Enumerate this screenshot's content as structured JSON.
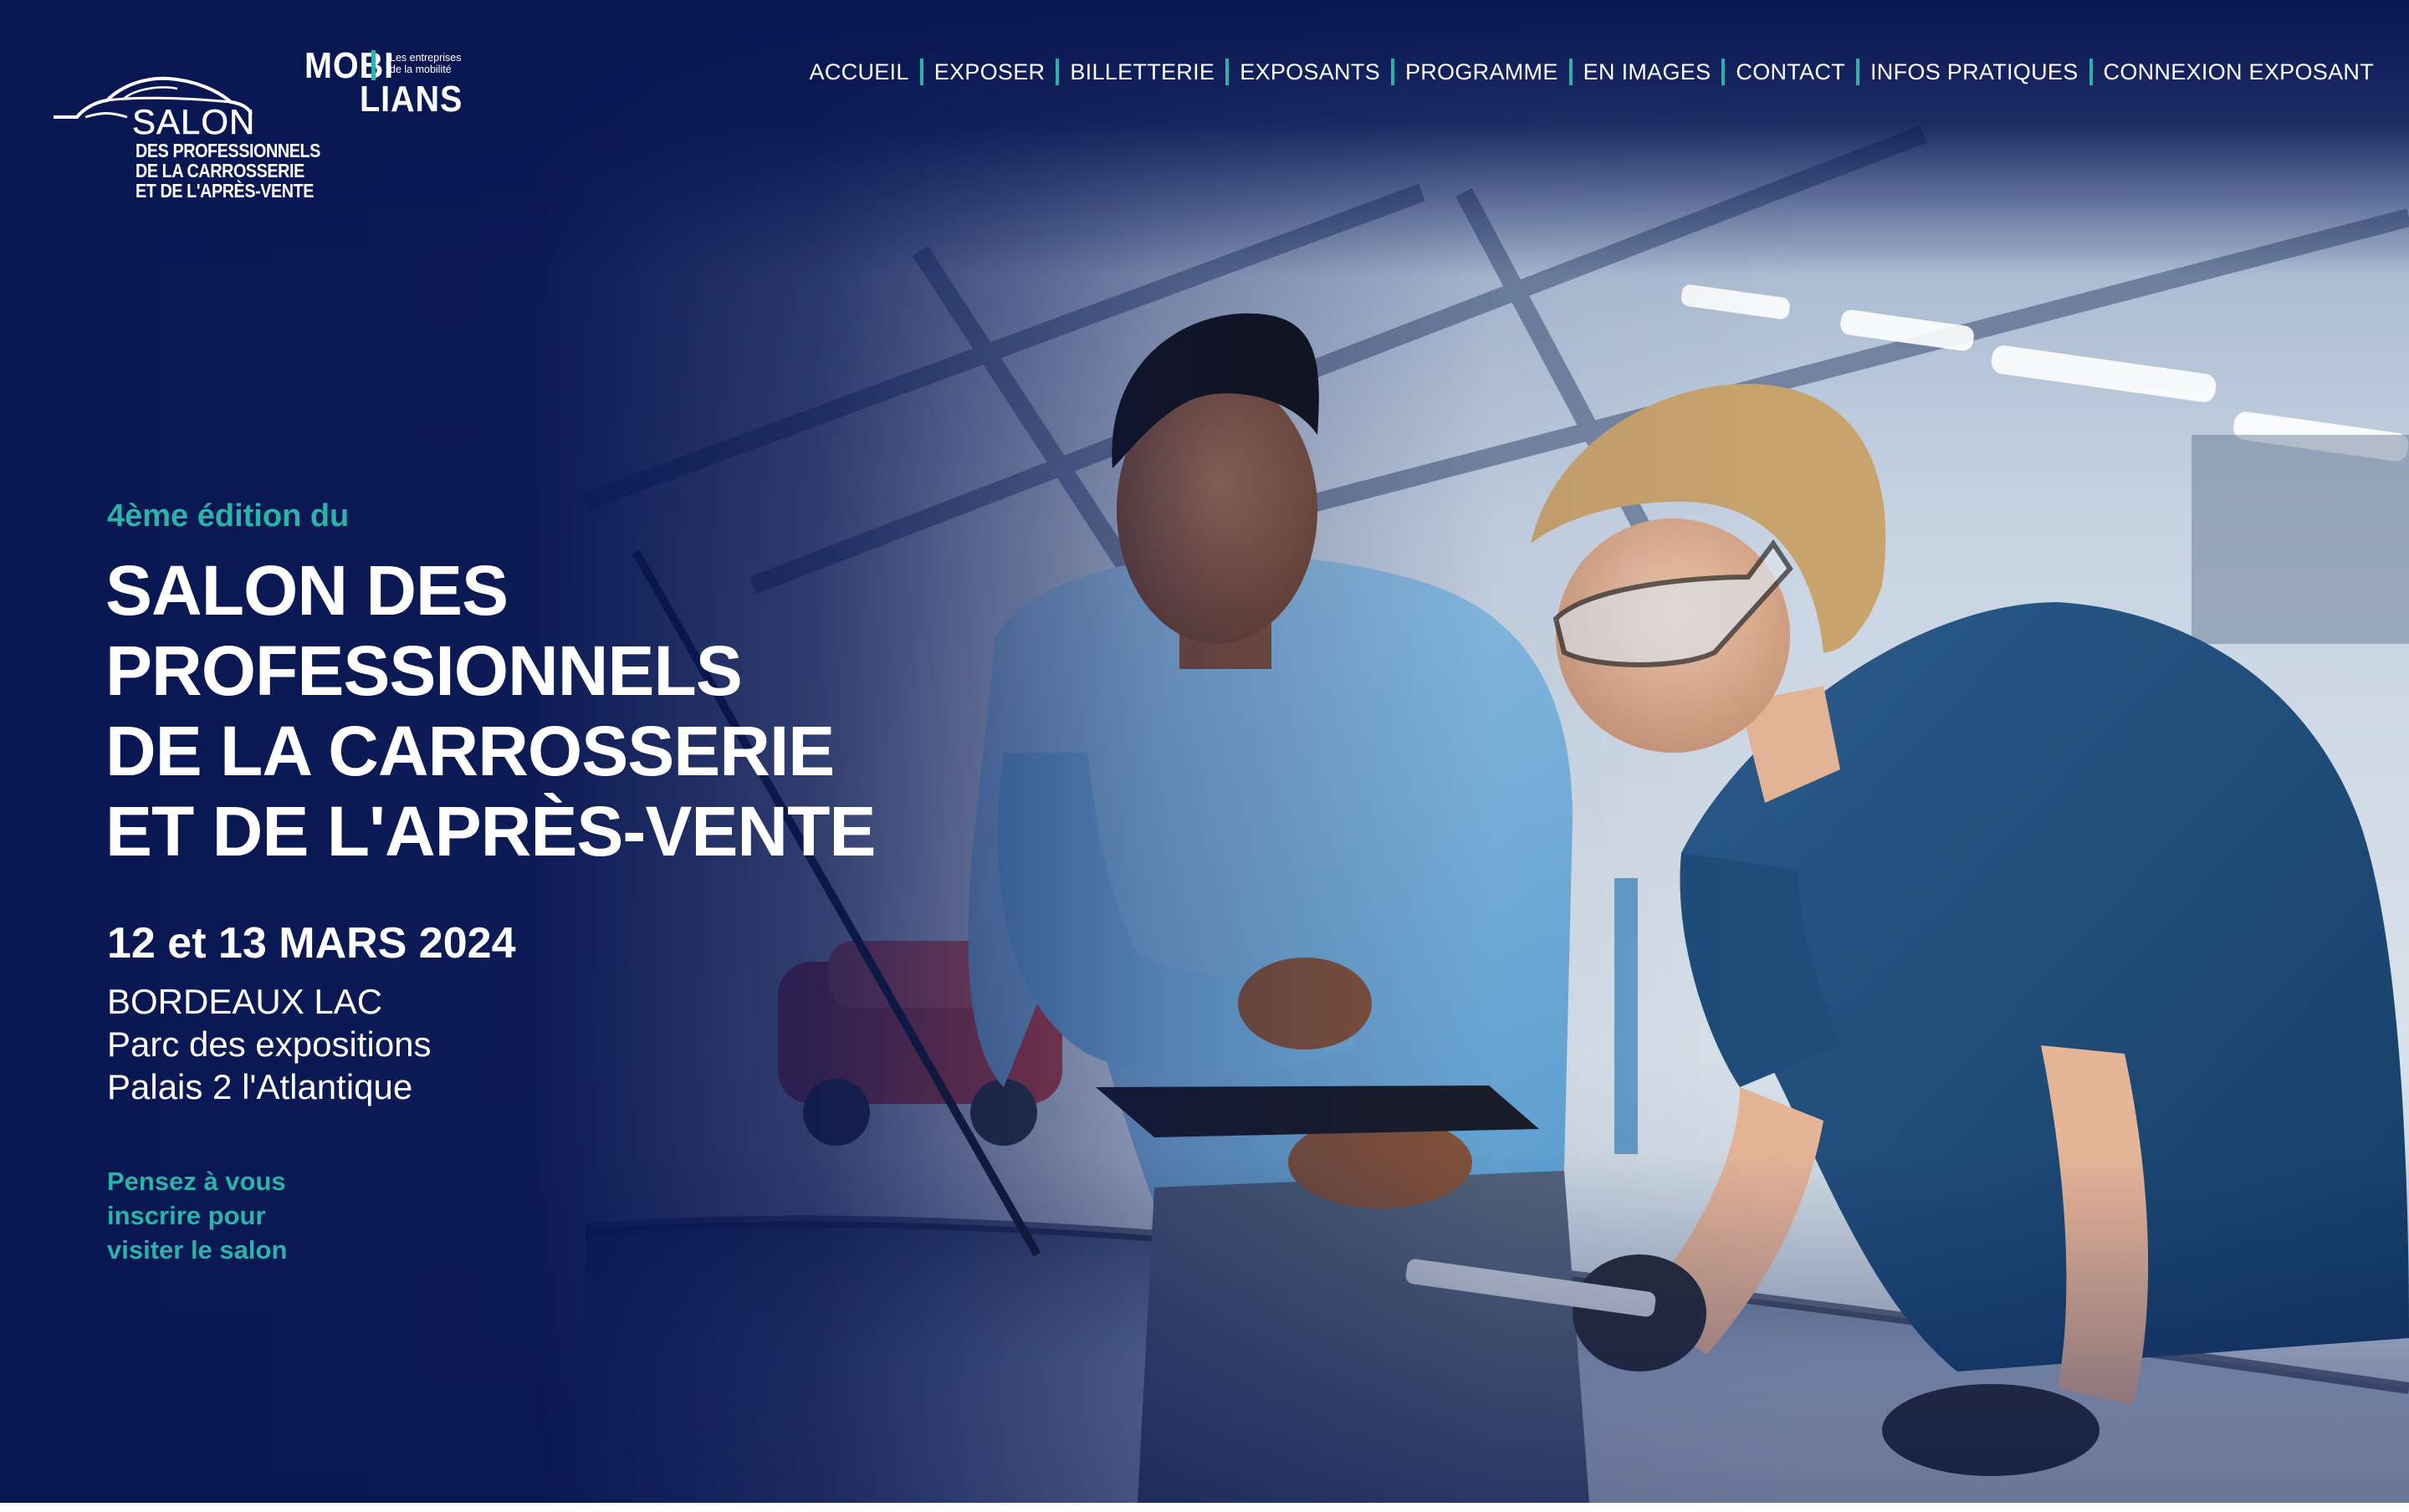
{
  "colors": {
    "navy": "#0a1a4e",
    "accent_teal": "#2bb3a8",
    "text_white": "#ffffff"
  },
  "logos": {
    "salon": {
      "word": "SALON",
      "lines": [
        "DES PROFESSIONNELS",
        "DE LA CARROSSERIE",
        "ET DE L'APRÈS-VENTE"
      ]
    },
    "mobilians": {
      "top": "MOBI",
      "bottom": "LIANS",
      "tagline_line1": "Les entreprises",
      "tagline_line2": "de la mobilité"
    }
  },
  "nav": {
    "items": [
      {
        "label": "ACCUEIL"
      },
      {
        "label": "EXPOSER"
      },
      {
        "label": "BILLETTERIE"
      },
      {
        "label": "EXPOSANTS"
      },
      {
        "label": "PROGRAMME"
      },
      {
        "label": "EN IMAGES"
      },
      {
        "label": "CONTACT"
      },
      {
        "label": "INFOS PRATIQUES"
      },
      {
        "label": "CONNEXION EXPOSANT"
      }
    ]
  },
  "hero": {
    "edition": "4ème édition du",
    "title_lines": [
      "SALON DES",
      "PROFESSIONNELS",
      "DE LA CARROSSERIE",
      "ET DE L'APRÈS-VENTE"
    ],
    "dates": "12 et 13 MARS 2024",
    "place_lines": [
      "BORDEAUX LAC",
      "Parc des expositions",
      "Palais 2 l'Atlantique"
    ],
    "cta_lines": [
      "Pensez à vous",
      "inscrire pour",
      "visiter le salon"
    ]
  }
}
